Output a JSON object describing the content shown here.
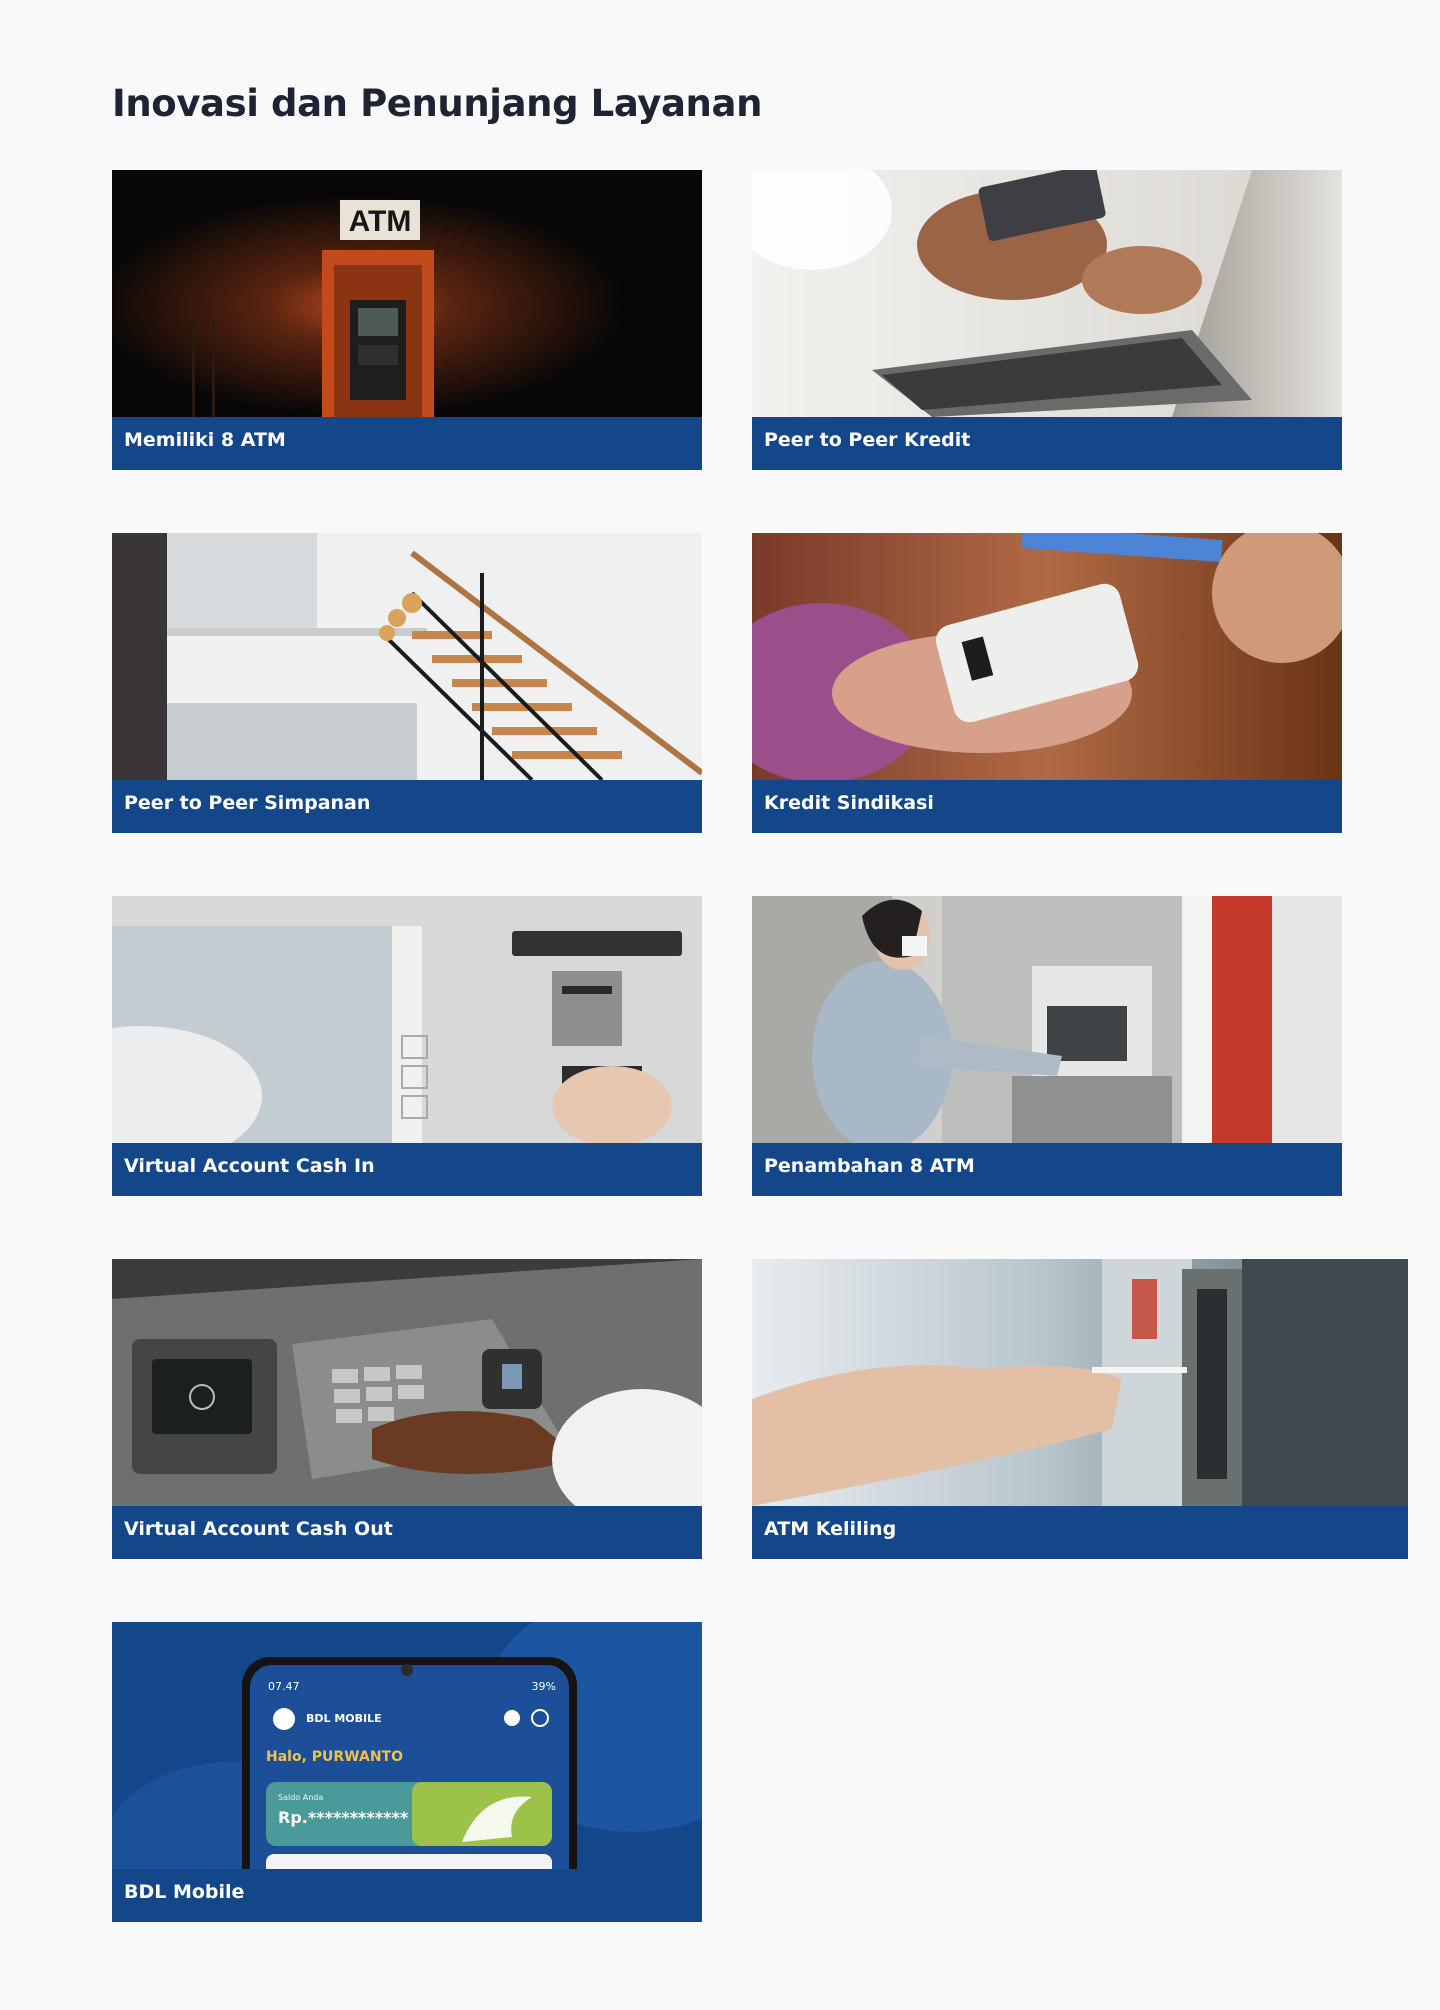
{
  "section": {
    "title": "Inovasi dan Penunjang Layanan"
  },
  "cards": [
    {
      "label": "Memiliki 8 ATM",
      "image": "atm-at-night"
    },
    {
      "label": "Peer to Peer Kredit",
      "image": "card-payment-laptop"
    },
    {
      "label": "Peer to Peer Simpanan",
      "image": "staircase-interior"
    },
    {
      "label": "Kredit Sindikasi",
      "image": "card-terminal-payment"
    },
    {
      "label": "Virtual Account Cash In",
      "image": "atm-card-slot"
    },
    {
      "label": "Penambahan 8 ATM",
      "image": "woman-using-atm"
    },
    {
      "label": "Virtual Account Cash Out",
      "image": "atm-keypad"
    },
    {
      "label": "ATM Keliling",
      "image": "card-insert-atm"
    },
    {
      "label": "BDL Mobile",
      "image": "bdl-mobile-app"
    }
  ],
  "phone": {
    "status_time": "07.47",
    "status_battery": "39%",
    "app_name": "BDL MOBILE",
    "greeting": "Halo, PURWANTO",
    "balance_label": "Saldo Anda",
    "balance_value": "Rp.************"
  },
  "photo_texts": {
    "atm_sign": "ATM"
  },
  "colors": {
    "page_background": "#f9f9f9",
    "title": "#1f2435",
    "caption_bar": "#14468a",
    "caption_text": "#ffffff"
  }
}
